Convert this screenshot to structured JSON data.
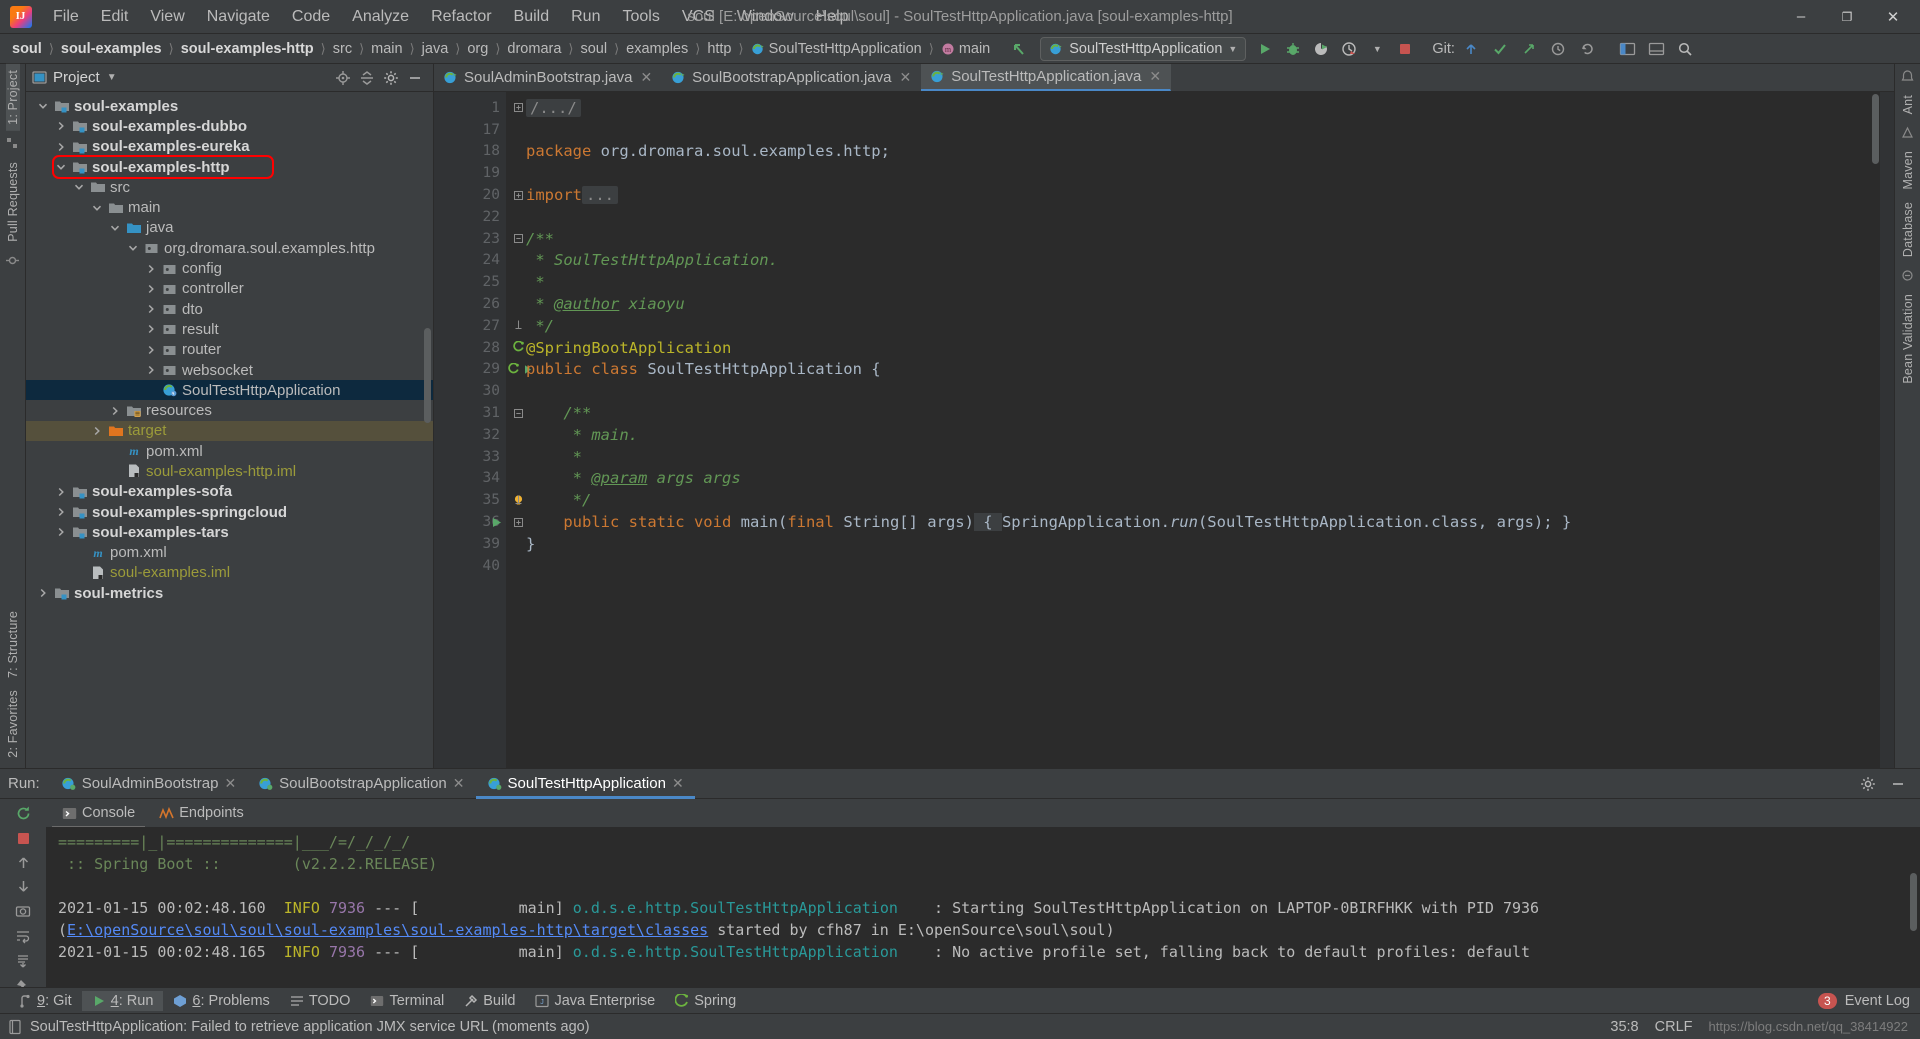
{
  "window": {
    "title": "soul [E:\\openSource\\soul\\soul] - SoulTestHttpApplication.java [soul-examples-http]",
    "minimize": "–",
    "maximize": "❐",
    "close": "✕"
  },
  "menubar": [
    {
      "label": "File"
    },
    {
      "label": "Edit"
    },
    {
      "label": "View"
    },
    {
      "label": "Navigate"
    },
    {
      "label": "Code"
    },
    {
      "label": "Analyze"
    },
    {
      "label": "Refactor"
    },
    {
      "label": "Build"
    },
    {
      "label": "Run"
    },
    {
      "label": "Tools"
    },
    {
      "label": "VCS"
    },
    {
      "label": "Window"
    },
    {
      "label": "Help"
    }
  ],
  "breadcrumbs": [
    {
      "label": "soul",
      "bold": true
    },
    {
      "label": "soul-examples",
      "bold": true
    },
    {
      "label": "soul-examples-http",
      "bold": true
    },
    {
      "label": "src",
      "bold": false
    },
    {
      "label": "main",
      "bold": false
    },
    {
      "label": "java",
      "bold": false
    },
    {
      "label": "org",
      "bold": false
    },
    {
      "label": "dromara",
      "bold": false
    },
    {
      "label": "soul",
      "bold": false
    },
    {
      "label": "examples",
      "bold": false
    },
    {
      "label": "http",
      "bold": false
    },
    {
      "label": "SoulTestHttpApplication",
      "bold": false,
      "icon": "class-icon"
    },
    {
      "label": "main",
      "bold": false,
      "icon": "method-icon"
    }
  ],
  "toolbar": {
    "run_config": "SoulTestHttpApplication",
    "git_label": "Git:",
    "icons": [
      "run-icon",
      "debug-icon",
      "coverage-icon",
      "profile-icon",
      "stop-icon"
    ],
    "git_icons": [
      "update-project-icon",
      "commit-icon",
      "push-icon",
      "history-icon",
      "revert-icon"
    ],
    "right_icons": [
      "settings-icon",
      "layout-icon",
      "search-icon"
    ]
  },
  "left_rail": {
    "top": [
      "1: Project"
    ],
    "items": [
      "Pull Requests"
    ],
    "bottom": [
      "7: Structure",
      "2: Favorites"
    ]
  },
  "right_rail": {
    "items": [
      "Ant",
      "Maven",
      "Database",
      "Bean Validation"
    ]
  },
  "project_panel": {
    "title": "Project",
    "tree": [
      {
        "label": "soul-examples",
        "indent": 1,
        "arrow": "down",
        "icon": "module-folder-icon",
        "style": "bold"
      },
      {
        "label": "soul-examples-dubbo",
        "indent": 2,
        "arrow": "right",
        "icon": "module-folder-icon",
        "style": "bold"
      },
      {
        "label": "soul-examples-eureka",
        "indent": 2,
        "arrow": "right",
        "icon": "module-folder-icon",
        "style": "bold"
      },
      {
        "label": "soul-examples-http",
        "indent": 2,
        "arrow": "down",
        "icon": "module-folder-icon",
        "style": "bold",
        "highlight": "redbox"
      },
      {
        "label": "src",
        "indent": 3,
        "arrow": "down",
        "icon": "folder-icon",
        "style": "plain"
      },
      {
        "label": "main",
        "indent": 4,
        "arrow": "down",
        "icon": "folder-icon",
        "style": "plain"
      },
      {
        "label": "java",
        "indent": 5,
        "arrow": "down",
        "icon": "source-folder-icon",
        "style": "plain"
      },
      {
        "label": "org.dromara.soul.examples.http",
        "indent": 6,
        "arrow": "down",
        "icon": "package-icon",
        "style": "plain"
      },
      {
        "label": "config",
        "indent": 7,
        "arrow": "right",
        "icon": "package-icon",
        "style": "plain"
      },
      {
        "label": "controller",
        "indent": 7,
        "arrow": "right",
        "icon": "package-icon",
        "style": "plain"
      },
      {
        "label": "dto",
        "indent": 7,
        "arrow": "right",
        "icon": "package-icon",
        "style": "plain"
      },
      {
        "label": "result",
        "indent": 7,
        "arrow": "right",
        "icon": "package-icon",
        "style": "plain"
      },
      {
        "label": "router",
        "indent": 7,
        "arrow": "right",
        "icon": "package-icon",
        "style": "plain"
      },
      {
        "label": "websocket",
        "indent": 7,
        "arrow": "right",
        "icon": "package-icon",
        "style": "plain"
      },
      {
        "label": "SoulTestHttpApplication",
        "indent": 7,
        "arrow": "none",
        "icon": "spring-class-icon",
        "style": "plain",
        "selected": true
      },
      {
        "label": "resources",
        "indent": 5,
        "arrow": "right",
        "icon": "resources-folder-icon",
        "style": "plain"
      },
      {
        "label": "target",
        "indent": 4,
        "arrow": "right",
        "icon": "excluded-folder-icon",
        "style": "olive",
        "rowHighlight": true
      },
      {
        "label": "pom.xml",
        "indent": 5,
        "arrow": "none",
        "icon": "maven-icon",
        "style": "plain"
      },
      {
        "label": "soul-examples-http.iml",
        "indent": 5,
        "arrow": "none",
        "icon": "iml-icon",
        "style": "olive"
      },
      {
        "label": "soul-examples-sofa",
        "indent": 2,
        "arrow": "right",
        "icon": "module-folder-icon",
        "style": "bold"
      },
      {
        "label": "soul-examples-springcloud",
        "indent": 2,
        "arrow": "right",
        "icon": "module-folder-icon",
        "style": "bold"
      },
      {
        "label": "soul-examples-tars",
        "indent": 2,
        "arrow": "right",
        "icon": "module-folder-icon",
        "style": "bold"
      },
      {
        "label": "pom.xml",
        "indent": 3,
        "arrow": "none",
        "icon": "maven-icon",
        "style": "plain"
      },
      {
        "label": "soul-examples.iml",
        "indent": 3,
        "arrow": "none",
        "icon": "iml-icon",
        "style": "olive"
      },
      {
        "label": "soul-metrics",
        "indent": 1,
        "arrow": "right",
        "icon": "module-folder-icon",
        "style": "bold"
      }
    ]
  },
  "editor": {
    "tabs": [
      {
        "label": "SoulAdminBootstrap.java",
        "active": false,
        "icon": "spring-class-icon"
      },
      {
        "label": "SoulBootstrapApplication.java",
        "active": false,
        "icon": "spring-class-icon"
      },
      {
        "label": "SoulTestHttpApplication.java",
        "active": true,
        "icon": "spring-class-icon"
      }
    ],
    "lines": [
      {
        "num": "1",
        "text": "/.../",
        "kind": "folded"
      },
      {
        "num": "17",
        "text": ""
      },
      {
        "num": "18",
        "text": "package org.dromara.soul.examples.http;",
        "kind": "package"
      },
      {
        "num": "19",
        "text": ""
      },
      {
        "num": "20",
        "text": "import ...",
        "kind": "import"
      },
      {
        "num": "22",
        "text": ""
      },
      {
        "num": "23",
        "text": "/**",
        "kind": "comment"
      },
      {
        "num": "24",
        "text": " * SoulTestHttpApplication.",
        "kind": "comment"
      },
      {
        "num": "25",
        "text": " *",
        "kind": "comment"
      },
      {
        "num": "26",
        "text": " * @author xiaoyu",
        "kind": "comment-author"
      },
      {
        "num": "27",
        "text": " */",
        "kind": "comment"
      },
      {
        "num": "28",
        "text": "@SpringBootApplication",
        "kind": "annotation"
      },
      {
        "num": "29",
        "text": "public class SoulTestHttpApplication {",
        "kind": "class-decl"
      },
      {
        "num": "30",
        "text": ""
      },
      {
        "num": "31",
        "text": "    /**",
        "kind": "comment"
      },
      {
        "num": "32",
        "text": "     * main.",
        "kind": "comment"
      },
      {
        "num": "33",
        "text": "     *",
        "kind": "comment"
      },
      {
        "num": "34",
        "text": "     * @param args args",
        "kind": "comment-param"
      },
      {
        "num": "35",
        "text": "     */",
        "kind": "comment"
      },
      {
        "num": "36",
        "text": "    public static void main(final String[] args) { SpringApplication.run(SoulTestHttpApplication.class, args); }",
        "kind": "method"
      },
      {
        "num": "39",
        "text": "}",
        "kind": "plain"
      },
      {
        "num": "40",
        "text": ""
      }
    ],
    "code_fragments": {
      "package_kw": "package",
      "package_name": " org.dromara.soul.examples.http;",
      "import_kw": "import",
      "import_ellipsis": "...",
      "author_tag": "@author",
      "author_name": " xiaoyu",
      "param_tag": "@param",
      "param_name": " args args",
      "annotation": "@SpringBootApplication",
      "class_modifiers": "public class ",
      "class_name": "SoulTestHttpApplication",
      "class_brace": " {",
      "method_sig_a": "public static void ",
      "method_name": "main",
      "method_open": "(",
      "method_final": "final",
      "method_args": " String[] args)",
      "method_body_open": " { ",
      "method_call_obj": "SpringApplication.",
      "method_call_fn": "run",
      "method_call_args": "(SoulTestHttpApplication.class, args); ",
      "method_body_close": "}"
    }
  },
  "run_panel": {
    "label": "Run:",
    "tabs": [
      {
        "label": "SoulAdminBootstrap",
        "active": false
      },
      {
        "label": "SoulBootstrapApplication",
        "active": false
      },
      {
        "label": "SoulTestHttpApplication",
        "active": true
      }
    ],
    "subtabs": [
      {
        "label": "Console",
        "active": true,
        "icon": "console-icon"
      },
      {
        "label": "Endpoints",
        "active": false,
        "icon": "endpoints-icon"
      }
    ],
    "rail_icons": [
      "rerun-icon",
      "stop-icon",
      "camera-icon",
      "export-icon",
      "print-icon",
      "wrap-icon",
      "scroll-end-icon",
      "pin-icon",
      "more-icon"
    ],
    "right_icons": [
      "settings-icon",
      "minimize-icon"
    ],
    "console": [
      {
        "parts": [
          {
            "t": "=========|_|==============|___/=/_/_/_/",
            "c": "green"
          }
        ]
      },
      {
        "parts": [
          {
            "t": " :: Spring Boot ::        (v2.2.2.RELEASE)",
            "c": "green"
          }
        ]
      },
      {
        "parts": [
          {
            "t": "",
            "c": "plain"
          }
        ]
      },
      {
        "parts": [
          {
            "t": "2021-01-15 00:02:48.160  ",
            "c": "plain"
          },
          {
            "t": "INFO",
            "c": "info"
          },
          {
            "t": " ",
            "c": "plain"
          },
          {
            "t": "7936",
            "c": "pid"
          },
          {
            "t": " --- [           main] ",
            "c": "plain"
          },
          {
            "t": "o.d.s.e.http.SoulTestHttpApplication",
            "c": "cls"
          },
          {
            "t": "    : Starting SoulTestHttpApplication on LAPTOP-0BIRFHKK with PID 7936",
            "c": "plain"
          }
        ]
      },
      {
        "parts": [
          {
            "t": "(",
            "c": "plain"
          },
          {
            "t": "E:\\openSource\\soul\\soul\\soul-examples\\soul-examples-http\\target\\classes",
            "c": "link"
          },
          {
            "t": " started by cfh87 in E:\\openSource\\soul\\soul)",
            "c": "plain"
          }
        ]
      },
      {
        "parts": [
          {
            "t": "2021-01-15 00:02:48.165  ",
            "c": "plain"
          },
          {
            "t": "INFO",
            "c": "info"
          },
          {
            "t": " ",
            "c": "plain"
          },
          {
            "t": "7936",
            "c": "pid"
          },
          {
            "t": " --- [           main] ",
            "c": "plain"
          },
          {
            "t": "o.d.s.e.http.SoulTestHttpApplication",
            "c": "cls"
          },
          {
            "t": "    : No active profile set, falling back to default profiles: default",
            "c": "plain"
          }
        ]
      }
    ]
  },
  "bottom_toolbar": {
    "items": [
      {
        "label": "9: Git",
        "prefix": "9",
        "rest": ": Git",
        "icon": "git-icon",
        "active": false
      },
      {
        "label": "4: Run",
        "prefix": "4",
        "rest": ": Run",
        "icon": "run-icon",
        "active": true
      },
      {
        "label": "6: Problems",
        "prefix": "6",
        "rest": ": Problems",
        "icon": "problems-icon",
        "active": false
      },
      {
        "label": "TODO",
        "prefix": "",
        "rest": "TODO",
        "icon": "todo-icon",
        "active": false
      },
      {
        "label": "Terminal",
        "prefix": "",
        "rest": "Terminal",
        "icon": "terminal-icon",
        "active": false
      },
      {
        "label": "Build",
        "prefix": "",
        "rest": "Build",
        "icon": "build-icon",
        "active": false
      },
      {
        "label": "Java Enterprise",
        "prefix": "",
        "rest": "Java Enterprise",
        "icon": "java-ee-icon",
        "active": false
      },
      {
        "label": "Spring",
        "prefix": "",
        "rest": "Spring",
        "icon": "spring-icon",
        "active": false
      }
    ],
    "event_log": "Event Log",
    "event_count": "3"
  },
  "statusbar": {
    "message": "SoulTestHttpApplication: Failed to retrieve application JMX service URL (moments ago)",
    "caret": "35:8",
    "line_sep": "CRLF",
    "watermark": "https://blog.csdn.net/qq_38414922"
  }
}
